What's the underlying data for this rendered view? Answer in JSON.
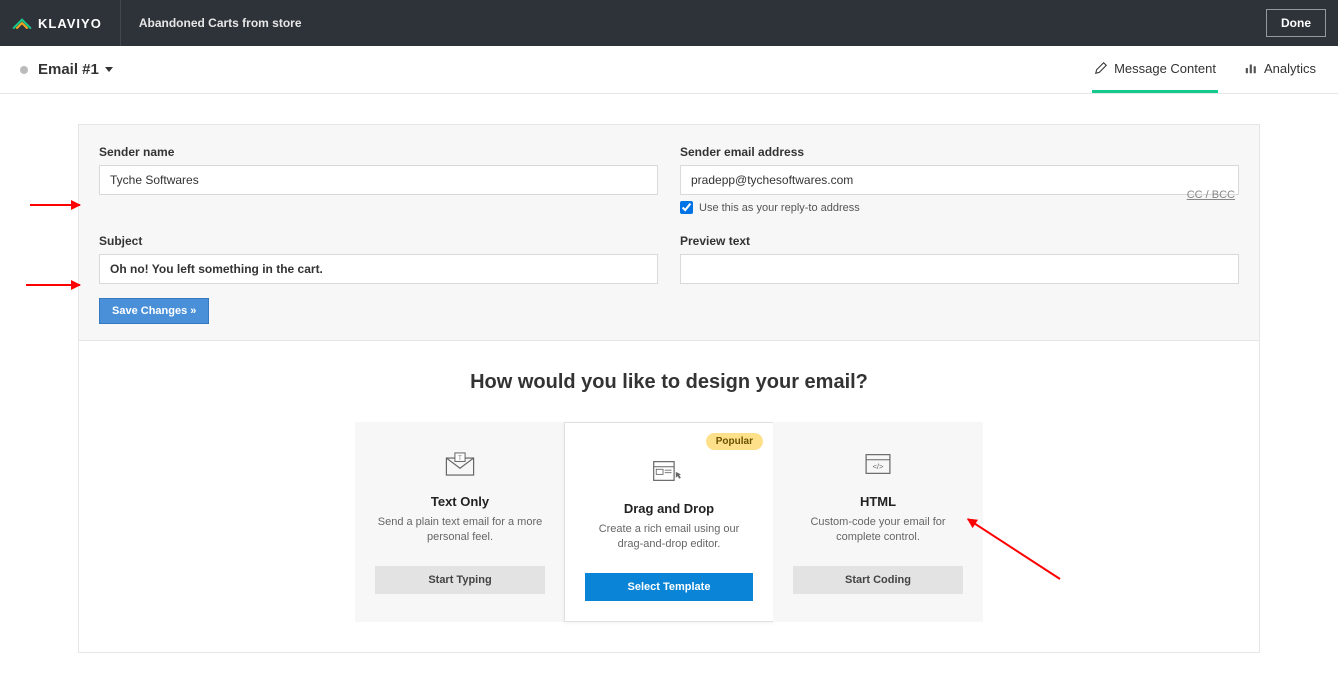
{
  "header": {
    "brand": "KLAVIYO",
    "flow_name": "Abandoned Carts from store",
    "done_label": "Done"
  },
  "subheader": {
    "email_title": "Email #1",
    "tabs": {
      "message_content": "Message Content",
      "analytics": "Analytics"
    }
  },
  "form": {
    "sender_name_label": "Sender name",
    "sender_name_value": "Tyche Softwares",
    "sender_email_label": "Sender email address",
    "sender_email_value": "pradepp@tychesoftwares.com",
    "reply_to_label": "Use this as your reply-to address",
    "ccbcc_label": "CC / BCC",
    "subject_label": "Subject",
    "subject_value": "Oh no! You left something in the cart.",
    "preview_label": "Preview text",
    "preview_value": "",
    "save_label": "Save Changes »"
  },
  "design": {
    "heading": "How would you like to design your email?",
    "options": [
      {
        "title": "Text Only",
        "desc": "Send a plain text email for a more personal feel.",
        "button": "Start Typing",
        "badge": "",
        "primary": false
      },
      {
        "title": "Drag and Drop",
        "desc": "Create a rich email using our drag-and-drop editor.",
        "button": "Select Template",
        "badge": "Popular",
        "primary": true
      },
      {
        "title": "HTML",
        "desc": "Custom-code your email for complete control.",
        "button": "Start Coding",
        "badge": "",
        "primary": false
      }
    ]
  }
}
